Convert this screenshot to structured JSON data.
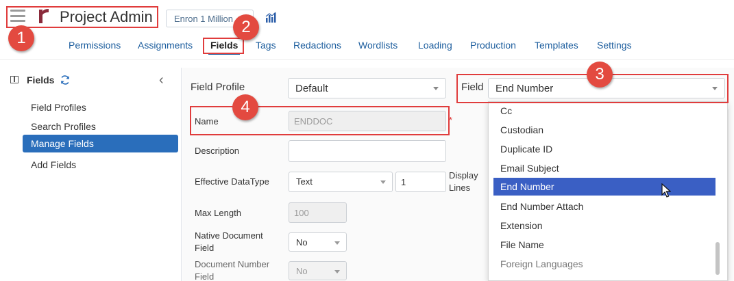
{
  "header": {
    "app_title": "Project Admin",
    "case_selector": "Enron 1 Million",
    "nav": [
      {
        "label": "Permissions"
      },
      {
        "label": "Assignments"
      },
      {
        "label": "Fields",
        "active": true
      },
      {
        "label": "Tags"
      },
      {
        "label": "Redactions"
      },
      {
        "label": "Wordlists"
      },
      {
        "label": "Loading"
      },
      {
        "label": "Production"
      },
      {
        "label": "Templates"
      },
      {
        "label": "Settings"
      }
    ]
  },
  "badges": [
    "1",
    "2",
    "3",
    "4"
  ],
  "sidebar": {
    "title": "Fields",
    "items": [
      {
        "label": "Field Profiles"
      },
      {
        "label": "Search Profiles"
      },
      {
        "label": "Manage Fields",
        "active": true
      },
      {
        "label": "Add Fields"
      }
    ]
  },
  "form": {
    "field_profile_label": "Field Profile",
    "field_profile_value": "Default",
    "field_label": "Field",
    "field_value": "End Number",
    "name_label": "Name",
    "name_value": "ENDDOC",
    "required_mark": "*",
    "description_label": "Description",
    "description_value": "",
    "datatype_label": "Effective DataType",
    "datatype_value": "Text",
    "display_lines_value": "1",
    "display_lines_label": "Display Lines",
    "max_length_label": "Max Length",
    "max_length_value": "100",
    "native_doc_label": "Native Document Field",
    "native_doc_value": "No",
    "doc_number_label": "Document Number Field",
    "doc_number_value": "No"
  },
  "dropdown": {
    "items": [
      {
        "label": "Cc"
      },
      {
        "label": "Custodian"
      },
      {
        "label": "Duplicate ID"
      },
      {
        "label": "Email Subject"
      },
      {
        "label": "End Number",
        "selected": true
      },
      {
        "label": "End Number Attach"
      },
      {
        "label": "Extension"
      },
      {
        "label": "File Name"
      },
      {
        "label": "Foreign Languages"
      }
    ]
  },
  "colors": {
    "accent": "#2a6ebb",
    "annotation_red": "#e03c3c",
    "selected_item": "#3a5fc4"
  }
}
